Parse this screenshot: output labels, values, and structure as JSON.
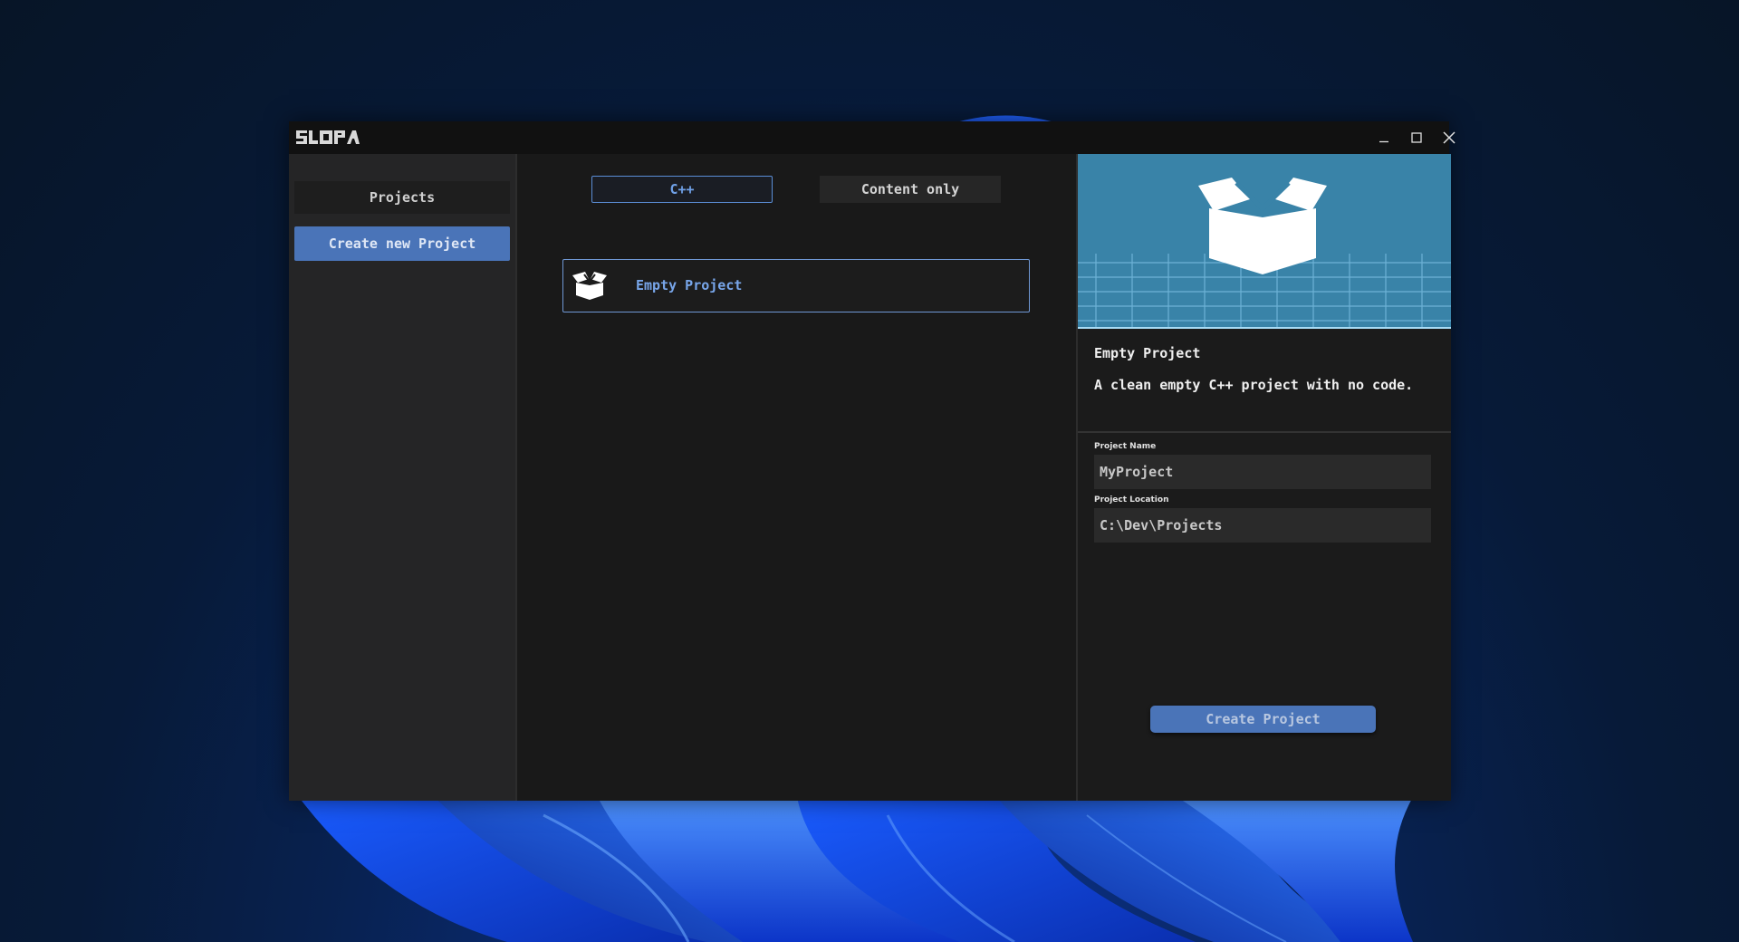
{
  "window": {
    "logo_text": "SLOPA",
    "controls": {
      "minimize": "minimize",
      "maximize": "maximize",
      "close": "close"
    }
  },
  "sidebar": {
    "header": "Projects",
    "create_button": "Create new Project"
  },
  "main": {
    "tabs": [
      {
        "label": "C++",
        "selected": true
      },
      {
        "label": "Content only",
        "selected": false
      }
    ],
    "templates": [
      {
        "label": "Empty Project",
        "icon": "box-icon",
        "selected": true
      }
    ]
  },
  "details": {
    "title": "Empty Project",
    "description": "A clean empty C++ project with no code.",
    "fields": {
      "name_label": "Project Name",
      "name_value": "MyProject",
      "location_label": "Project Location",
      "location_value": "C:\\Dev\\Projects"
    },
    "create_button": "Create Project"
  },
  "colors": {
    "accent": "#4a74b8",
    "accent_text": "#6fa0e6",
    "preview_bg": "#3983a8"
  }
}
